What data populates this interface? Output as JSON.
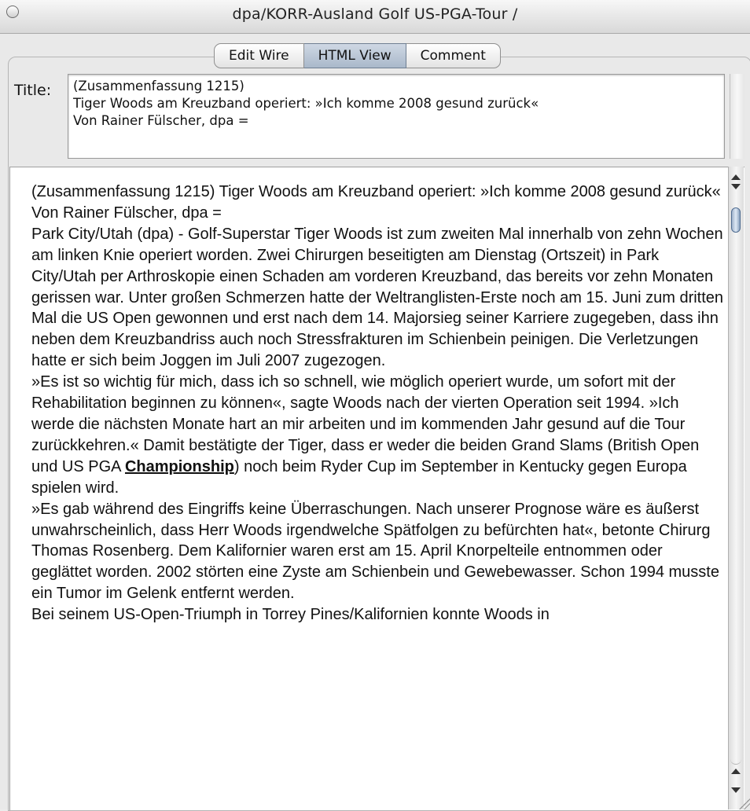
{
  "window": {
    "title": "dpa/KORR-Ausland Golf US-PGA-Tour /"
  },
  "tabs": [
    {
      "label": "Edit Wire",
      "selected": false
    },
    {
      "label": "HTML View",
      "selected": true
    },
    {
      "label": "Comment",
      "selected": false
    }
  ],
  "title_field": {
    "label": "Title:",
    "value": "(Zusammenfassung 1215)\nTiger Woods am Kreuzband operiert: »Ich komme 2008 gesund zurück«\nVon Rainer Fülscher, dpa ="
  },
  "body": {
    "p1": "(Zusammenfassung 1215) Tiger Woods am Kreuzband operiert: »Ich komme 2008 gesund zurück« Von Rainer Fülscher, dpa =",
    "p2": "Park City/Utah (dpa) - Golf-Superstar Tiger Woods ist zum zweiten Mal innerhalb von zehn Wochen am linken Knie operiert worden. Zwei Chirurgen beseitigten am Dienstag (Ortszeit) in Park City/Utah per Arthroskopie einen Schaden am vorderen Kreuzband, das bereits vor zehn Monaten gerissen war. Unter großen Schmerzen hatte der Weltranglisten-Erste noch am 15. Juni zum dritten Mal die US Open gewonnen und erst nach dem 14. Majorsieg seiner Karriere zugegeben, dass ihn neben dem Kreuzbandriss auch noch Stressfrakturen im Schienbein peinigen. Die Verletzungen hatte er sich beim Joggen im Juli 2007 zugezogen.",
    "p3_before": "»Es ist so wichtig für mich, dass ich so schnell, wie möglich operiert wurde, um sofort mit der Rehabilitation beginnen zu können«, sagte Woods nach der vierten Operation seit 1994. »Ich werde die nächsten Monate hart an mir arbeiten und im kommenden Jahr gesund auf die Tour zurückkehren.« Damit bestätigte der Tiger, dass er weder die beiden Grand Slams (British Open und US PGA ",
    "p3_link": "Championship",
    "p3_after": ") noch beim Ryder Cup im September in Kentucky gegen Europa spielen wird.",
    "p4": "»Es gab während des Eingriffs keine Überraschungen. Nach unserer Prognose wäre es äußerst unwahrscheinlich, dass Herr Woods irgendwelche Spätfolgen zu befürchten hat«, betonte Chirurg Thomas Rosenberg. Dem Kalifornier waren erst am 15. April Knorpelteile entnommen oder geglättet worden. 2002 störten eine Zyste am Schienbein und Gewebewasser. Schon 1994 musste ein Tumor im Gelenk entfernt werden.",
    "p5": "Bei seinem US-Open-Triumph in Torrey Pines/Kalifornien konnte Woods in"
  },
  "icons": {
    "close": "close-circle-icon",
    "scroll_up": "arrow-up-icon",
    "scroll_down": "arrow-down-icon"
  }
}
